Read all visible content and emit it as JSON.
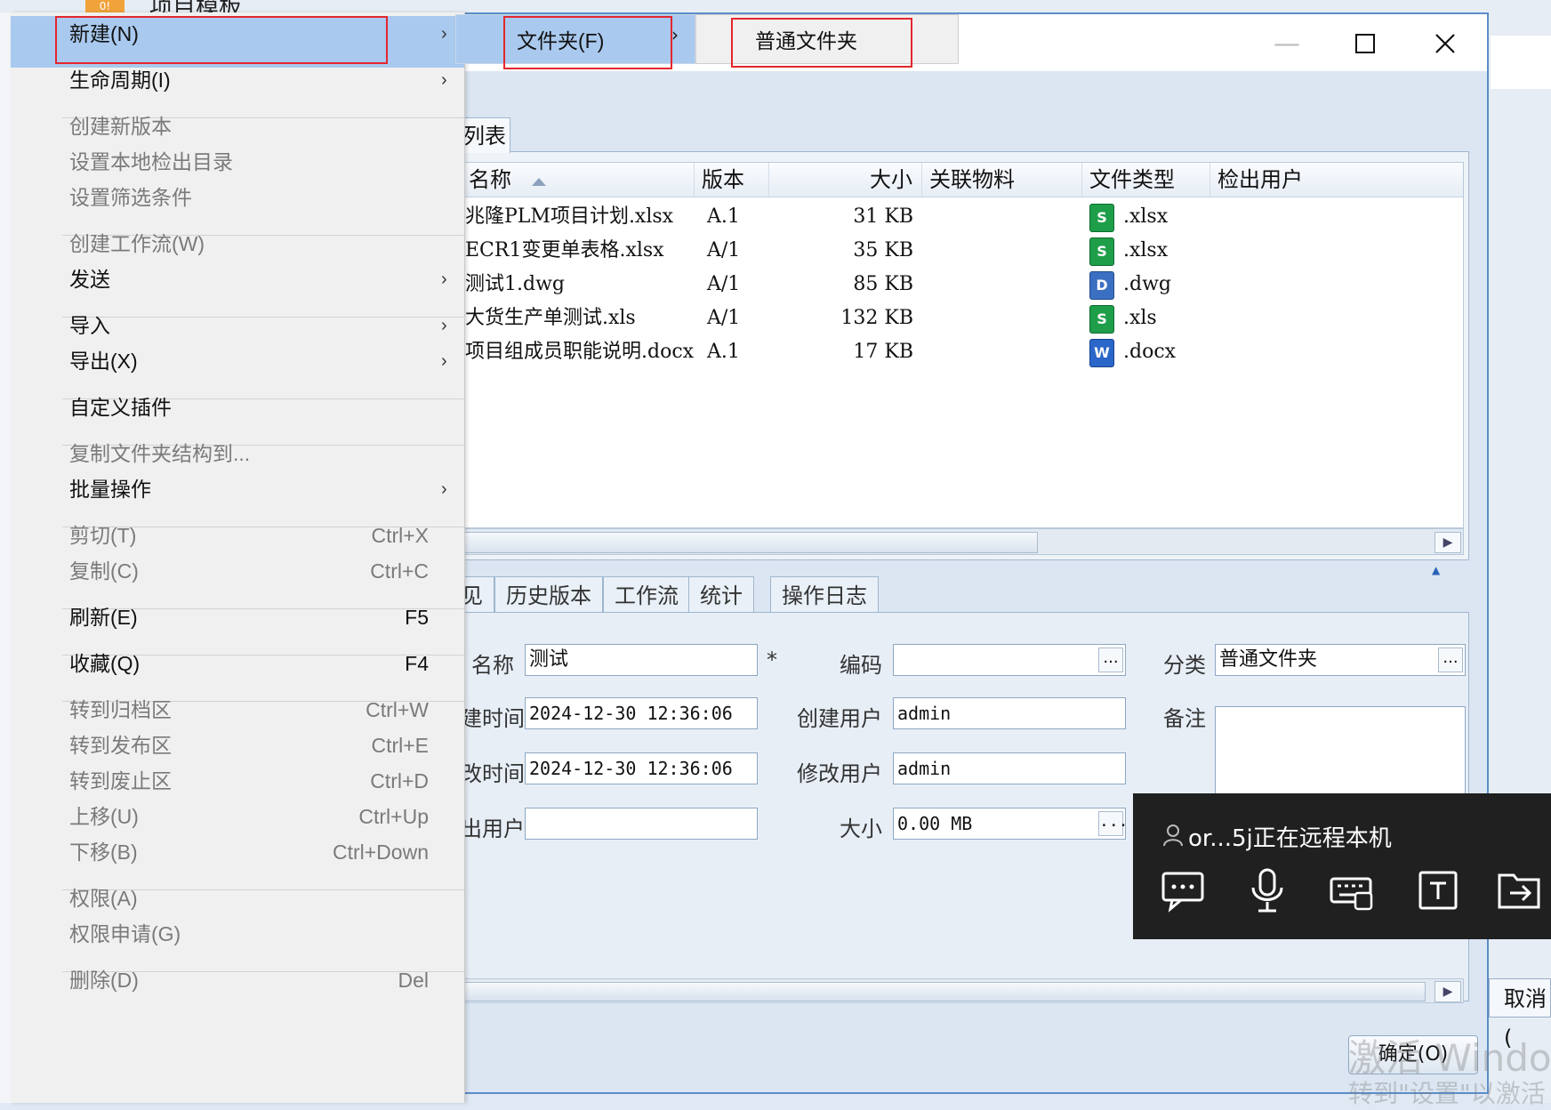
{
  "background": {
    "top_tab_icon": "0!",
    "top_tab_title": "项目模板",
    "cancel_button": "取消("
  },
  "window": {
    "min_glyph": "—",
    "max_glyph": "☐",
    "close_glyph": "✕"
  },
  "list": {
    "tab_label": "列表",
    "columns": {
      "name": "名称",
      "version": "版本",
      "size": "大小",
      "material": "关联物料",
      "filetype": "文件类型",
      "checkout_user": "检出用户"
    },
    "rows": [
      {
        "name": "兆隆PLM项目计划.xlsx",
        "version": "A.1",
        "size": "31 KB",
        "type": ".xlsx",
        "icon": "excel-icon"
      },
      {
        "name": "ECR1变更单表格.xlsx",
        "version": "A/1",
        "size": "35 KB",
        "type": ".xlsx",
        "icon": "excel-icon"
      },
      {
        "name": "测试1.dwg",
        "version": "A/1",
        "size": "85 KB",
        "type": ".dwg",
        "icon": "dwg-icon"
      },
      {
        "name": "大货生产单测试.xls",
        "version": "A/1",
        "size": "132 KB",
        "type": ".xls",
        "icon": "excel-icon"
      },
      {
        "name": "项目组成员职能说明.docx",
        "version": "A.1",
        "size": "17 KB",
        "type": ".docx",
        "icon": "word-icon"
      }
    ]
  },
  "details": {
    "tabs": [
      "历史版本",
      "工作流",
      "统计",
      "操作日志"
    ],
    "first_tab_partial": "见",
    "fields": {
      "name_label": "名称",
      "name_value": "测试",
      "required_mark": "*",
      "code_label": "编码",
      "code_value": "",
      "category_label": "分类",
      "category_value": "普通文件夹",
      "created_time_label": "建时间",
      "created_time_value": "2024-12-30 12:36:06",
      "created_user_label": "创建用户",
      "created_user_value": "admin",
      "remark_label": "备注",
      "modified_time_label": "改时间",
      "modified_time_value": "2024-12-30 12:36:06",
      "modified_user_label": "修改用户",
      "modified_user_value": "admin",
      "checkout_user_label": "出用户",
      "checkout_user_value": "",
      "size_label": "大小",
      "size_value": "0.00 MB"
    },
    "ellipsis": "..."
  },
  "buttons": {
    "ok": "确定(O)"
  },
  "watermark": {
    "line1": "激活 Windows",
    "line2": "转到\"设置\"以激活"
  },
  "context_menu": {
    "items": [
      {
        "label": "新建(N)",
        "has_sub": true
      },
      {
        "label": "生命周期(I)",
        "has_sub": true
      },
      {
        "label": "创建新版本"
      },
      {
        "label": "设置本地检出目录"
      },
      {
        "label": "设置筛选条件"
      },
      {
        "label": "创建工作流(W)"
      },
      {
        "label": "发送",
        "has_sub": true
      },
      {
        "label": "导入",
        "has_sub": true
      },
      {
        "label": "导出(X)",
        "has_sub": true
      },
      {
        "label": "自定义插件"
      },
      {
        "label": "复制文件夹结构到..."
      },
      {
        "label": "批量操作",
        "has_sub": true
      },
      {
        "label": "剪切(T)",
        "shortcut": "Ctrl+X"
      },
      {
        "label": "复制(C)",
        "shortcut": "Ctrl+C"
      },
      {
        "label": "刷新(E)",
        "shortcut": "F5"
      },
      {
        "label": "收藏(Q)",
        "shortcut": "F4"
      },
      {
        "label": "转到归档区",
        "shortcut": "Ctrl+W"
      },
      {
        "label": "转到发布区",
        "shortcut": "Ctrl+E"
      },
      {
        "label": "转到废止区",
        "shortcut": "Ctrl+D"
      },
      {
        "label": "上移(U)",
        "shortcut": "Ctrl+Up"
      },
      {
        "label": "下移(B)",
        "shortcut": "Ctrl+Down"
      },
      {
        "label": "权限(A)"
      },
      {
        "label": "权限申请(G)"
      },
      {
        "label": "删除(D)",
        "shortcut": "Del"
      }
    ],
    "arrow": "›"
  },
  "submenu": {
    "folder": "文件夹(F)",
    "normal_folder": "普通文件夹"
  },
  "remote": {
    "status_text": "or...5j正在远程本机",
    "icons": [
      "chat-icon",
      "microphone-icon",
      "keyboard-icon",
      "text-icon",
      "file-transfer-icon"
    ]
  },
  "colors": {
    "highlight": "#a9c9ee",
    "annotation_red": "#e4262d",
    "window_border": "#5b8dc9",
    "overlay_bg": "#202020"
  }
}
